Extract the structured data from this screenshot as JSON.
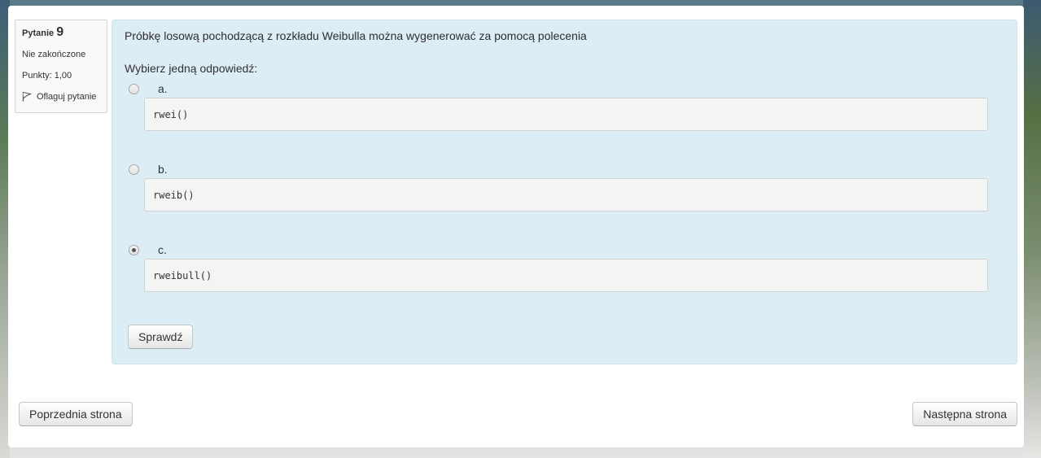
{
  "question_info": {
    "label": "Pytanie",
    "number": "9",
    "status": "Nie zakończone",
    "points": "Punkty: 1,00",
    "flag_label": "Oflaguj pytanie"
  },
  "question": {
    "text": "Próbkę losową pochodzącą z rozkładu Weibulla można wygenerować za pomocą polecenia",
    "prompt": "Wybierz jedną odpowiedź:",
    "answers": [
      {
        "letter": "a.",
        "code": "rwei()",
        "selected": false
      },
      {
        "letter": "b.",
        "code": "rweib()",
        "selected": false
      },
      {
        "letter": "c.",
        "code": "rweibull()",
        "selected": true
      }
    ],
    "check_button": "Sprawdź"
  },
  "navigation": {
    "prev": "Poprzednia strona",
    "next": "Następna strona"
  },
  "icons": {
    "flag": "flag-icon"
  }
}
